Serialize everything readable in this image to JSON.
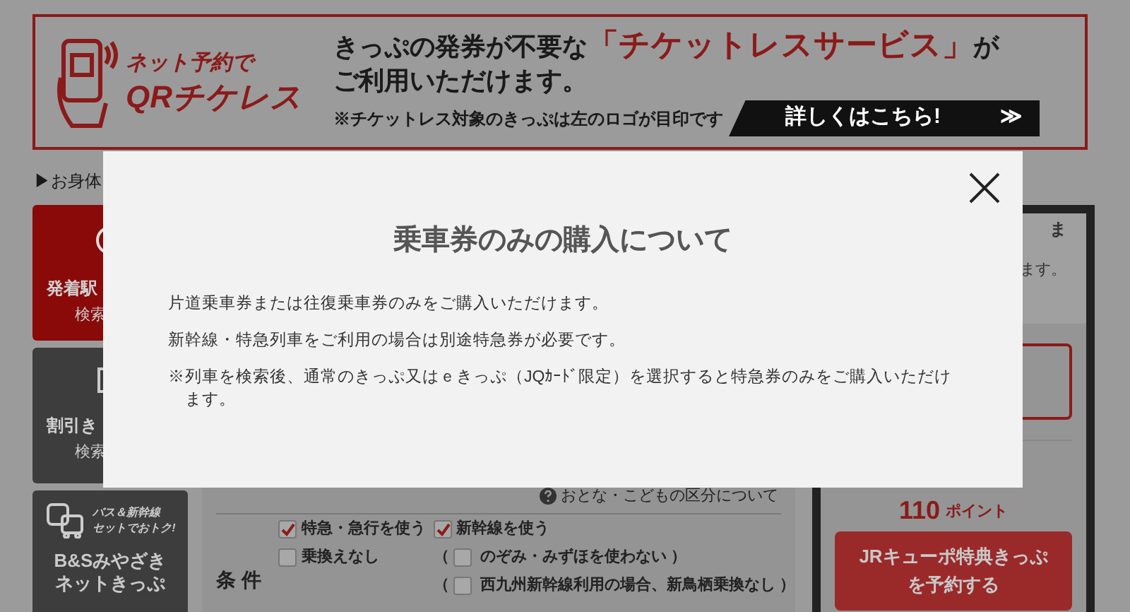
{
  "banner": {
    "logo_line1": "ネット予約で",
    "logo_line2": "QRチケレス",
    "headline_before": "きっぷの発券が不要な",
    "headline_highlight": "「チケットレスサービス」",
    "headline_after": "が",
    "headline_line2": "ご利用いただけます。",
    "note": "※チケットレス対象のきっぷは左のロゴが目印です",
    "details_button": "詳しくはこちら!",
    "details_arrow": "≫"
  },
  "notice_link": "▶お身体",
  "side_menu": [
    {
      "kind": "search",
      "selected": true,
      "line1": "発着駅",
      "line2": "検索"
    },
    {
      "kind": "discount",
      "selected": false,
      "line1": "割引き",
      "line2": "検索"
    },
    {
      "kind": "bus",
      "selected": false,
      "tag_line1": "バス＆新幹線",
      "tag_line2": "セットでおトク!",
      "line1": "B&Sみやざき",
      "line2": "ネットきっぷ"
    }
  ],
  "search_form": {
    "help_link": "おとな・こどもの区分について",
    "conditions_label": "条 件",
    "column_1": [
      {
        "kind": "plain",
        "label": "特急・急行を使う",
        "checked": true
      },
      {
        "kind": "plain",
        "label": "乗換えなし",
        "checked": false
      }
    ],
    "column_2": [
      {
        "kind": "plain",
        "label": "新幹線を使う",
        "checked": true
      },
      {
        "kind": "paren",
        "prefix": "（",
        "label": "のぞみ・みずほを使わない",
        "suffix": "）",
        "checked": false
      },
      {
        "kind": "paren",
        "prefix": "（",
        "label": "西九州新幹線利用の場合、新鳥栖乗換なし",
        "suffix": "）",
        "checked": false
      }
    ]
  },
  "points_panel": {
    "text_line1": "ま",
    "text_line2": "ます。",
    "points": "110",
    "points_unit": "ポイント",
    "reserve_button_line1": "JRキューポ特典きっぷ",
    "reserve_button_line2": "を予約する"
  },
  "modal": {
    "title": "乗車券のみの購入について",
    "paragraphs": [
      "片道乗車券または往復乗車券のみをご購入いただけます。",
      "新幹線・特急列車をご利用の場合は別途特急券が必要です。",
      "※列車を検索後、通常のきっぷ又はｅきっぷ（JQｶｰﾄﾞ限定）を選択すると特急券のみをご購入いただけます。"
    ]
  }
}
